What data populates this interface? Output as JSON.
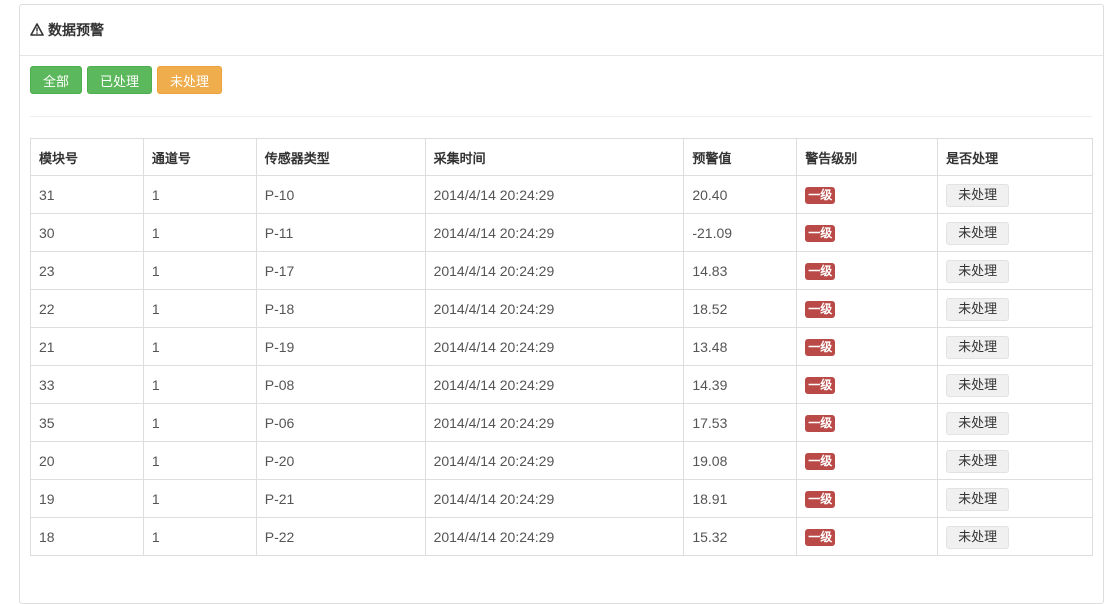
{
  "panel": {
    "title": "数据预警",
    "icon": "warning-triangle-icon"
  },
  "filters": {
    "all_label": "全部",
    "processed_label": "已处理",
    "unprocessed_label": "未处理"
  },
  "table": {
    "headers": [
      "模块号",
      "通道号",
      "传感器类型",
      "采集时间",
      "预警值",
      "警告级别",
      "是否处理"
    ],
    "rows": [
      {
        "module": "31",
        "channel": "1",
        "sensor": "P-10",
        "time": "2014/4/14 20:24:29",
        "value": "20.40",
        "level": "一级",
        "status": "未处理"
      },
      {
        "module": "30",
        "channel": "1",
        "sensor": "P-11",
        "time": "2014/4/14 20:24:29",
        "value": "-21.09",
        "level": "一级",
        "status": "未处理"
      },
      {
        "module": "23",
        "channel": "1",
        "sensor": "P-17",
        "time": "2014/4/14 20:24:29",
        "value": "14.83",
        "level": "一级",
        "status": "未处理"
      },
      {
        "module": "22",
        "channel": "1",
        "sensor": "P-18",
        "time": "2014/4/14 20:24:29",
        "value": "18.52",
        "level": "一级",
        "status": "未处理"
      },
      {
        "module": "21",
        "channel": "1",
        "sensor": "P-19",
        "time": "2014/4/14 20:24:29",
        "value": "13.48",
        "level": "一级",
        "status": "未处理"
      },
      {
        "module": "33",
        "channel": "1",
        "sensor": "P-08",
        "time": "2014/4/14 20:24:29",
        "value": "14.39",
        "level": "一级",
        "status": "未处理"
      },
      {
        "module": "35",
        "channel": "1",
        "sensor": "P-06",
        "time": "2014/4/14 20:24:29",
        "value": "17.53",
        "level": "一级",
        "status": "未处理"
      },
      {
        "module": "20",
        "channel": "1",
        "sensor": "P-20",
        "time": "2014/4/14 20:24:29",
        "value": "19.08",
        "level": "一级",
        "status": "未处理"
      },
      {
        "module": "19",
        "channel": "1",
        "sensor": "P-21",
        "time": "2014/4/14 20:24:29",
        "value": "18.91",
        "level": "一级",
        "status": "未处理"
      },
      {
        "module": "18",
        "channel": "1",
        "sensor": "P-22",
        "time": "2014/4/14 20:24:29",
        "value": "15.32",
        "level": "一级",
        "status": "未处理"
      }
    ]
  },
  "colors": {
    "success": "#5cb85c",
    "warning": "#f0ad4e",
    "danger_badge": "#b94a48"
  }
}
